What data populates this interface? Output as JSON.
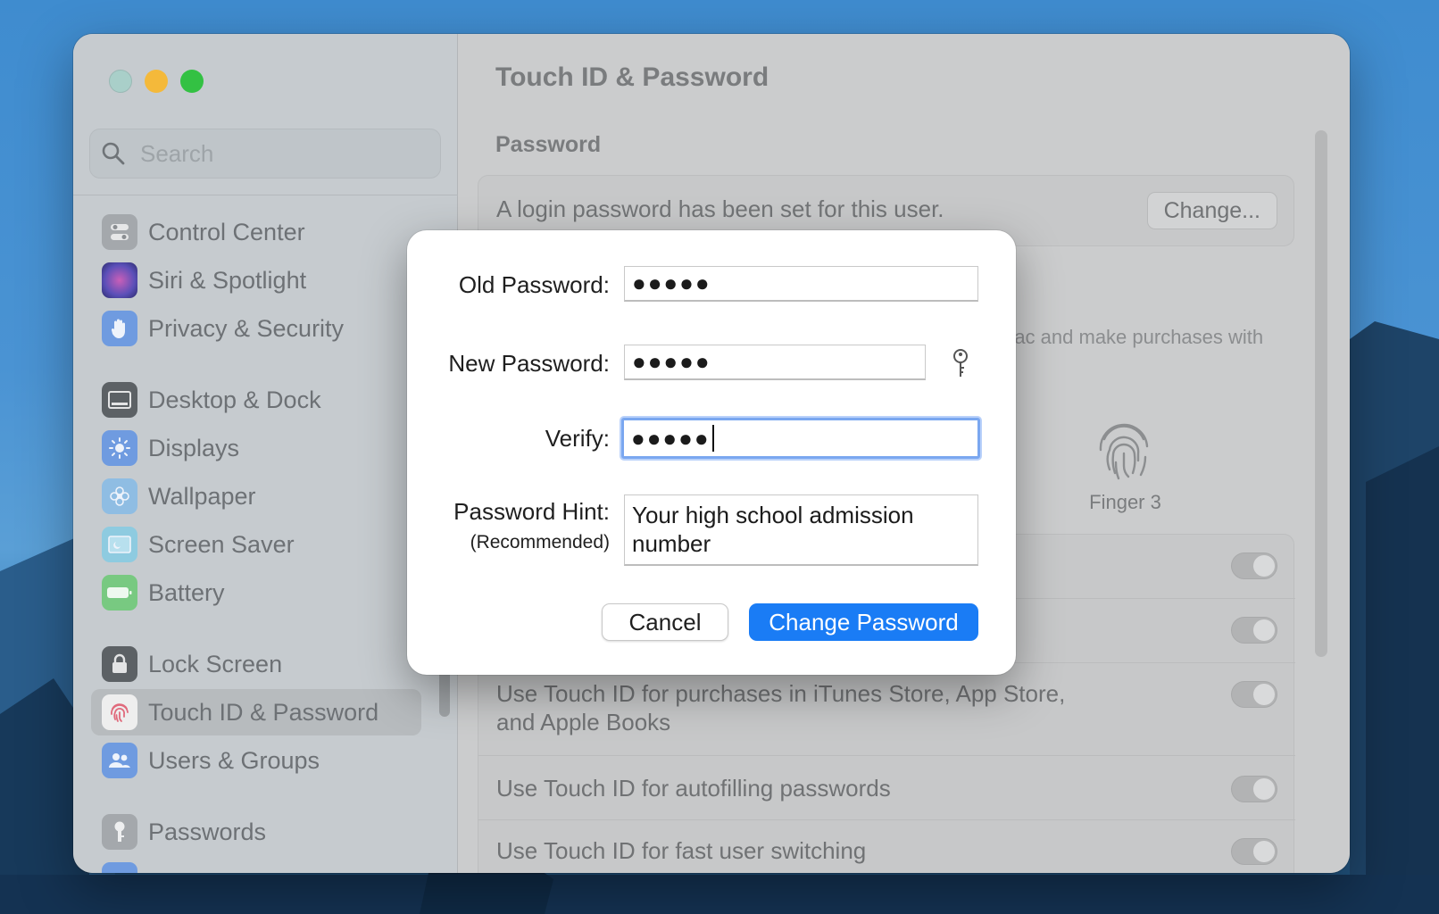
{
  "window": {
    "traffic_lights": [
      "close",
      "minimize",
      "maximize"
    ]
  },
  "sidebar": {
    "search_placeholder": "Search",
    "items": [
      {
        "label": "Control Center",
        "icon": "control-center-icon",
        "color": "#9ea2a6"
      },
      {
        "label": "Siri & Spotlight",
        "icon": "siri-icon",
        "color": "#8a6fd0"
      },
      {
        "label": "Privacy & Security",
        "icon": "hand-icon",
        "color": "#5b8ee0"
      },
      {
        "label": "Desktop & Dock",
        "icon": "dock-icon",
        "color": "#555a5e"
      },
      {
        "label": "Displays",
        "icon": "sun-icon",
        "color": "#5b8ee0"
      },
      {
        "label": "Wallpaper",
        "icon": "flower-icon",
        "color": "#7ab3e0"
      },
      {
        "label": "Screen Saver",
        "icon": "screen-saver-icon",
        "color": "#7cc0d8"
      },
      {
        "label": "Battery",
        "icon": "battery-icon",
        "color": "#5fbf6b"
      },
      {
        "label": "Lock Screen",
        "icon": "lock-icon",
        "color": "#555a5e"
      },
      {
        "label": "Touch ID & Password",
        "icon": "fingerprint-icon",
        "color": "#f2f2f2",
        "selected": true
      },
      {
        "label": "Users & Groups",
        "icon": "users-icon",
        "color": "#5b8ee0"
      },
      {
        "label": "Passwords",
        "icon": "key-icon",
        "color": "#9ea2a6"
      }
    ]
  },
  "main": {
    "title": "Touch ID & Password",
    "password_section": {
      "title": "Password",
      "status": "A login password has been set for this user.",
      "change_label": "Change..."
    },
    "touchid_partial": "Mac and make purchases with",
    "finger_label": "Finger 3",
    "rows": [
      {
        "text": "",
        "toggle": true
      },
      {
        "text": "",
        "toggle": true
      },
      {
        "text": "Use Touch ID for purchases in iTunes Store, App Store,\nand Apple Books",
        "toggle": true
      },
      {
        "text": "Use Touch ID for autofilling passwords",
        "toggle": true
      },
      {
        "text": "Use Touch ID for fast user switching",
        "toggle": true
      }
    ]
  },
  "dialog": {
    "old_password_label": "Old Password:",
    "old_password_value": "●●●●●",
    "new_password_label": "New Password:",
    "new_password_value": "●●●●●",
    "verify_label": "Verify:",
    "verify_value": "●●●●●",
    "hint_label": "Password Hint:",
    "hint_sublabel": "(Recommended)",
    "hint_value": "Your high school admission number",
    "cancel_label": "Cancel",
    "submit_label": "Change Password"
  }
}
